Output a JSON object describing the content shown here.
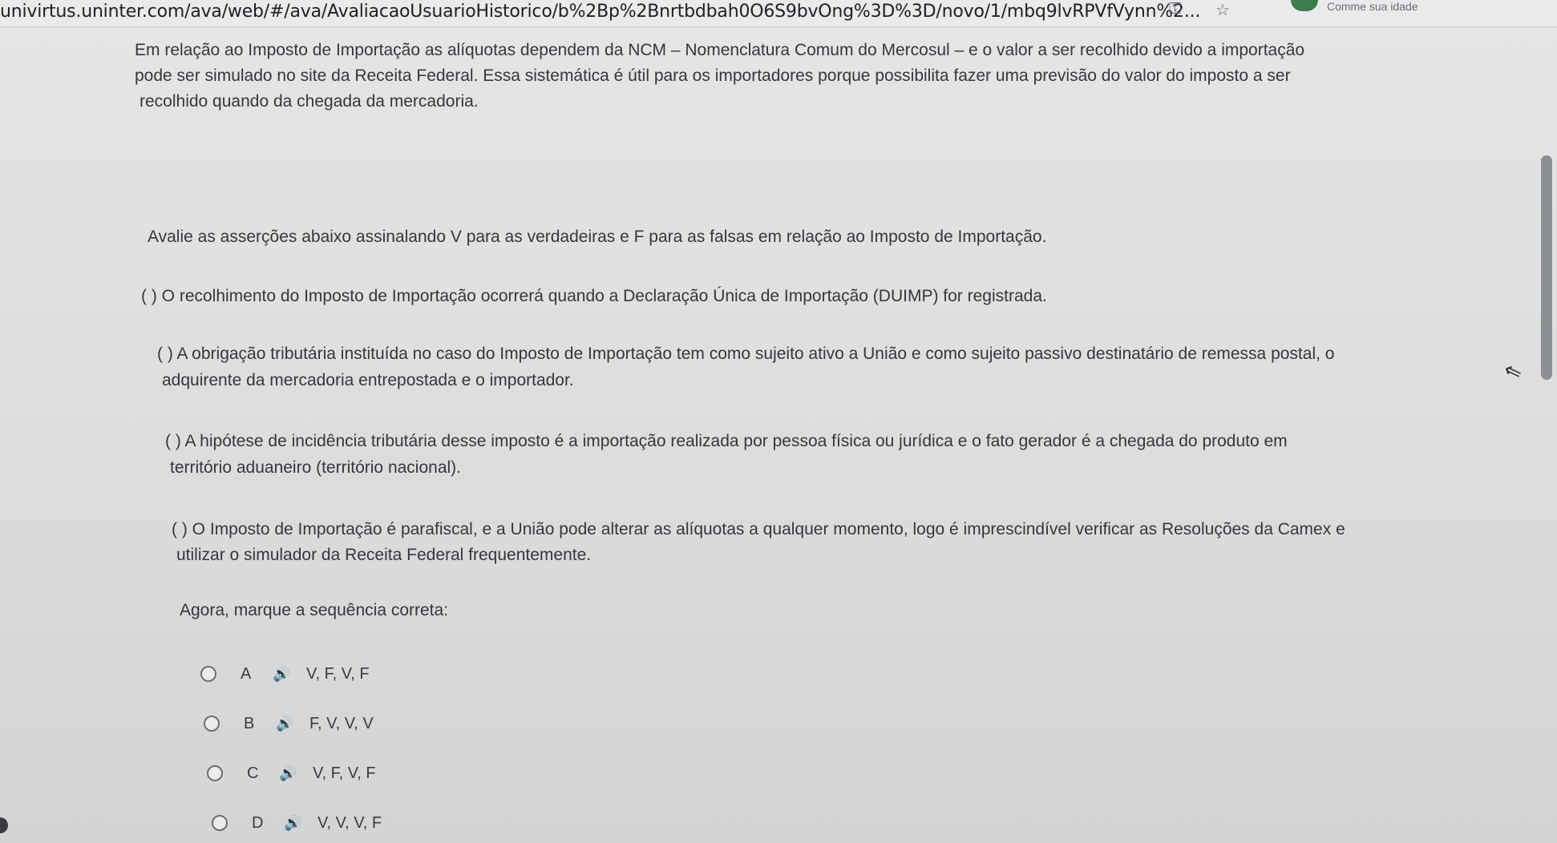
{
  "browser": {
    "url": "univirtus.uninter.com/ava/web/#/ava/AvaliacaoUsuarioHistorico/b%2Bp%2Bnrtbdbah0O6S9bvOng%3D%3D/novo/1/mbq9lvRPVfVynn%2...",
    "tail_text": "Comme sua idade"
  },
  "question": {
    "intro": [
      "Em relação ao Imposto de Importação as alíquotas dependem da NCM – Nomenclatura Comum do Mercosul – e o valor a ser recolhido devido a importação",
      "pode ser simulado no site da Receita Federal. Essa sistemática é útil para os importadores porque possibilita fazer uma previsão do valor do imposto a ser",
      "recolhido quando da chegada da mercadoria."
    ],
    "instruction": "Avalie as asserções abaixo assinalando V para as verdadeiras e F para as falsas em relação ao Imposto de Importação.",
    "assertions": [
      [
        "( ) O recolhimento do Imposto de Importação ocorrerá quando a Declaração Única de Importação (DUIMP) for registrada."
      ],
      [
        "( ) A obrigação tributária instituída no caso do Imposto de Importação tem como sujeito ativo a União e como sujeito passivo destinatário de remessa postal, o",
        "adquirente da mercadoria entrepostada e o importador."
      ],
      [
        "( ) A hipótese de incidência tributária desse imposto é a importação realizada por pessoa física ou jurídica e o fato gerador é a chegada do produto em",
        "território aduaneiro (território nacional)."
      ],
      [
        "( ) O Imposto de Importação é parafiscal, e a União pode alterar as alíquotas a  qualquer momento, logo é imprescindível verificar as Resoluções da Camex e",
        "utilizar o simulador da Receita Federal frequentemente."
      ]
    ],
    "prompt": "Agora, marque a sequência correta:"
  },
  "options": [
    {
      "letter": "A",
      "text": "V, F, V, F"
    },
    {
      "letter": "B",
      "text": "F, V, V, V"
    },
    {
      "letter": "C",
      "text": "V, F, V, F"
    },
    {
      "letter": "D",
      "text": "V, V, V, F"
    }
  ],
  "icons": {
    "speaker": "🔊",
    "star": "☆",
    "key": "⚿",
    "cursor": "⇖"
  },
  "colors": {
    "page_background": "#dedfe0",
    "text": "#35373b",
    "scrollbar": "#8c8f93"
  }
}
